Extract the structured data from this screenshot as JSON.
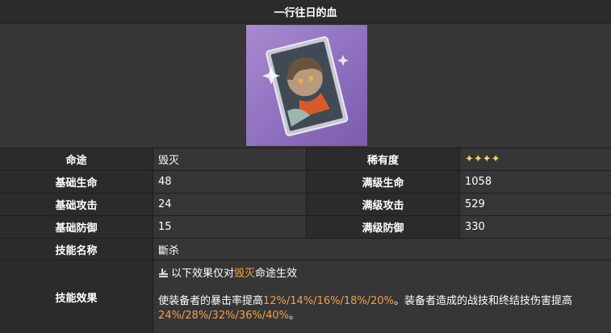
{
  "title": "一行往日的血",
  "rows": {
    "path": {
      "label": "命途",
      "value": "毁灭"
    },
    "rarity": {
      "label": "稀有度",
      "value": "✦✦✦✦"
    },
    "base_hp": {
      "label": "基础生命",
      "value": "48"
    },
    "max_hp": {
      "label": "满级生命",
      "value": "1058"
    },
    "base_atk": {
      "label": "基础攻击",
      "value": "24"
    },
    "max_atk": {
      "label": "满级攻击",
      "value": "529"
    },
    "base_def": {
      "label": "基础防御",
      "value": "15"
    },
    "max_def": {
      "label": "满级防御",
      "value": "330"
    },
    "skill_name": {
      "label": "技能名称",
      "value": "斷杀"
    },
    "skill_effect": {
      "label": "技能效果",
      "note_prefix": "以下效果仅对",
      "note_path": "毁灭",
      "note_suffix": "命途生效",
      "desc_1": "使装备者的暴击率提高",
      "desc_1_values": "12%/14%/16%/18%/20%",
      "desc_2": "。装备者造成的战技和终结技伤害提高",
      "desc_2_values": "24%/28%/32%/36%/40%",
      "desc_end": "。"
    }
  },
  "colors": {
    "highlight": "#f0a04b",
    "star": "#f3d26b",
    "card_bg": "#8f6fbf"
  },
  "icons": {
    "path_icon": "destruction-path-icon",
    "card": "light-cone-card-art"
  }
}
